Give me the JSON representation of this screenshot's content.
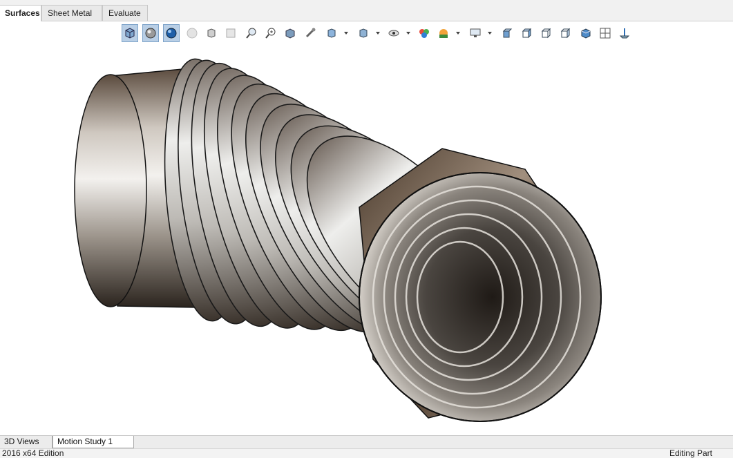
{
  "ribbon_tabs": [
    {
      "label": "Surfaces",
      "active": true
    },
    {
      "label": "Sheet Metal",
      "active": false
    },
    {
      "label": "Evaluate",
      "active": false
    }
  ],
  "heads_up_toolbar": {
    "icons": [
      "shaded-with-edges-icon",
      "shaded-icon",
      "realview-sphere-icon",
      "ambient-occlusion-icon",
      "view-orientation-cube-icon",
      "section-view-icon",
      "zoom-to-fit-icon",
      "zoom-to-area-icon",
      "previous-view-icon",
      "rotate-view-icon",
      "display-style-icon",
      "hide-show-items-icon",
      "visibility-icon",
      "edit-appearance-icon",
      "apply-scene-icon",
      "view-settings-icon",
      "monitor-icon",
      "front-view-icon",
      "isometric-view-icon",
      "trimetric-view-icon",
      "dimetric-view-icon",
      "shaded-cube-icon",
      "four-view-icon",
      "normal-to-icon"
    ]
  },
  "bottom_tabs": [
    {
      "label": "3D Views",
      "active": false
    },
    {
      "label": "Motion Study 1",
      "active": true
    }
  ],
  "status_bar": {
    "left": "2016 x64 Edition",
    "right": "Editing Part"
  }
}
